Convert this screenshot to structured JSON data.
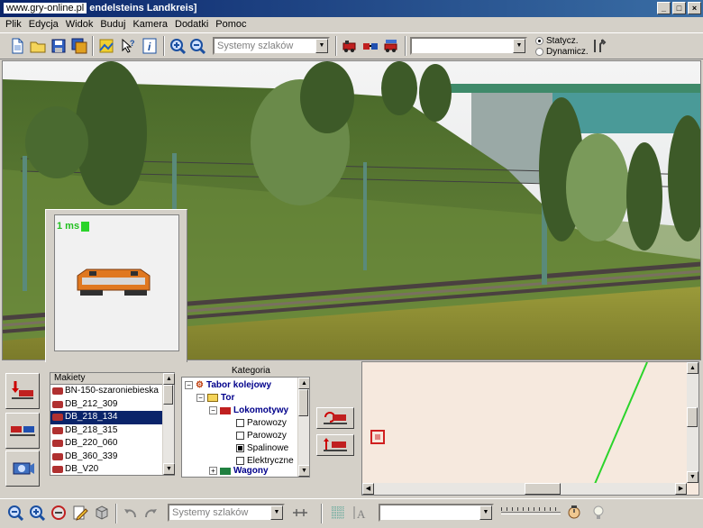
{
  "window": {
    "watermark": "www.gry-online.pl",
    "title": "endelsteins Landkreis]",
    "controls": [
      "_",
      "□",
      "×"
    ]
  },
  "menu": [
    "Plik",
    "Edycja",
    "Widok",
    "Buduj",
    "Kamera",
    "Dodatki",
    "Pomoc"
  ],
  "toolbar": {
    "layer_select": "Systemy szlaków",
    "object_select": "",
    "radio_static": "Statycz.",
    "radio_dynamic": "Dynamicz.",
    "radio_selected": "static"
  },
  "preview": {
    "fps_label": "1 ms"
  },
  "models_list": {
    "header": "Makiety",
    "items": [
      "BN-150-szaroniebieska",
      "DB_212_309",
      "DB_218_134",
      "DB_218_315",
      "DB_220_060",
      "DB_360_339",
      "DB_V20"
    ],
    "selected_index": 2
  },
  "category": {
    "label": "Kategoria",
    "tree": {
      "root": "Tabor kolejowy",
      "track": "Tor",
      "locomotives": "Lokomotywy",
      "types": [
        "Parowozy",
        "Parowozy",
        "Spalinowe",
        "Elektryczne"
      ],
      "checked_index": 2,
      "wagons": "Wagony"
    }
  },
  "status": {
    "layer_select": "Systemy szlaków",
    "select2": ""
  },
  "colors": {
    "selection": "#0a246a",
    "track_line": "#2bd42b",
    "map_bg": "#f6e9de"
  }
}
